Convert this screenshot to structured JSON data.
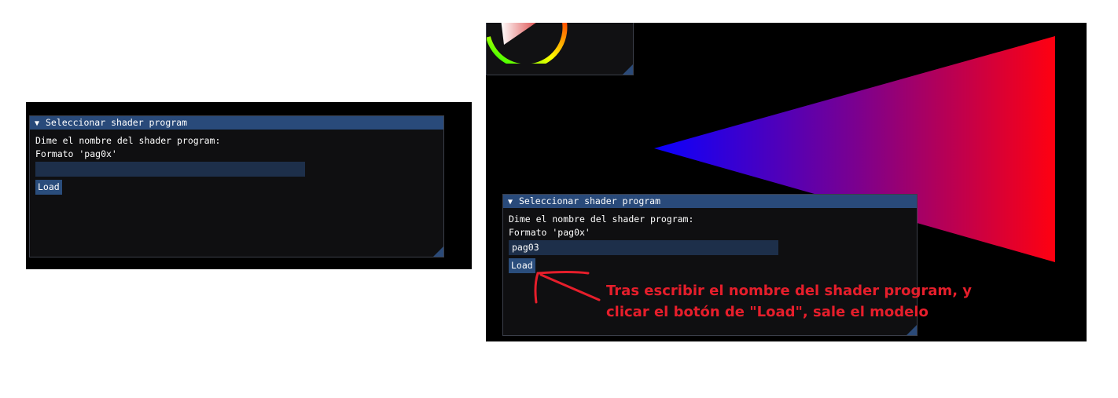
{
  "left_window": {
    "title": "Seleccionar shader program",
    "collapse_glyph": "▼",
    "prompt": "Dime el nombre del shader program:",
    "format_hint": "Formato 'pag0x'",
    "input_value": "",
    "load_label": "Load"
  },
  "right_window": {
    "title": "Seleccionar shader program",
    "collapse_glyph": "▼",
    "prompt": "Dime el nombre del shader program:",
    "format_hint": "Formato 'pag0x'",
    "input_value": "pag03",
    "load_label": "Load"
  },
  "annotation": {
    "line1": "Tras escribir el nombre del shader program, y",
    "line2": "clicar el botón de \"Load\", sale el modelo",
    "color": "#e61e2b"
  },
  "scene": {
    "background": "#000000",
    "triangle_gradient": [
      "#0a00ff",
      "#ff0010"
    ],
    "icons": [
      "color-wheel-icon",
      "resize-grip-icon",
      "annotation-arrow-icon"
    ]
  }
}
